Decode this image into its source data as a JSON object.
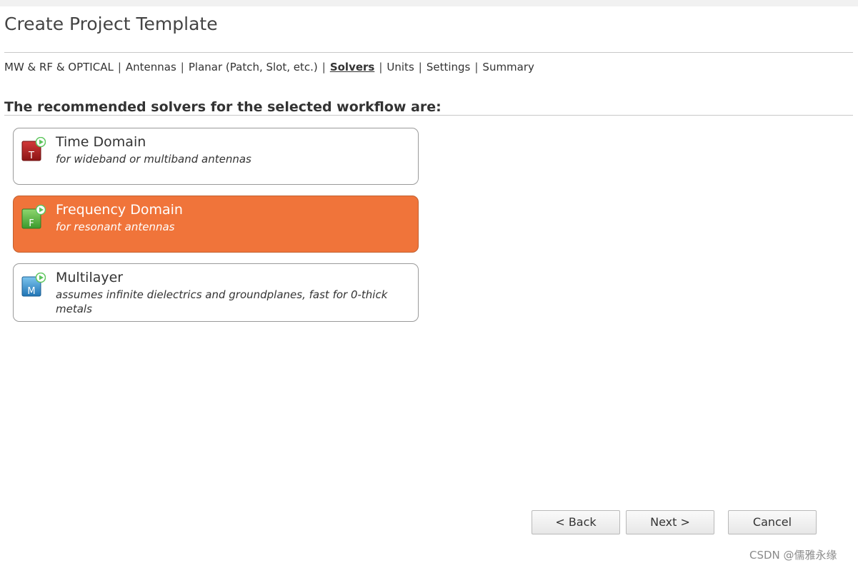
{
  "page": {
    "title": "Create Project Template"
  },
  "breadcrumb": {
    "items": [
      {
        "label": "MW & RF & OPTICAL"
      },
      {
        "label": "Antennas"
      },
      {
        "label": "Planar (Patch, Slot, etc.)"
      },
      {
        "label": "Solvers",
        "active": true
      },
      {
        "label": "Units"
      },
      {
        "label": "Settings"
      },
      {
        "label": "Summary"
      }
    ],
    "separator": "|"
  },
  "heading": "The recommended solvers for the selected workflow are:",
  "solvers": [
    {
      "title": "Time Domain",
      "description": "for wideband or multiband antennas",
      "icon": "time-domain-solver-icon",
      "letter": "T",
      "color": "#a01c1c",
      "selected": false
    },
    {
      "title": "Frequency Domain",
      "description": "for resonant antennas",
      "icon": "frequency-domain-solver-icon",
      "letter": "F",
      "color": "#4aa53a",
      "selected": true
    },
    {
      "title": "Multilayer",
      "description": "assumes infinite dielectrics and groundplanes, fast for 0-thick metals",
      "icon": "multilayer-solver-icon",
      "letter": "M",
      "color": "#2a86c4",
      "selected": false
    }
  ],
  "buttons": {
    "back": "< Back",
    "next": "Next >",
    "cancel": "Cancel"
  },
  "watermark": "CSDN @儒雅永缘",
  "colors": {
    "selected_bg": "#f0743a",
    "play_badge": "#5cc55c"
  }
}
